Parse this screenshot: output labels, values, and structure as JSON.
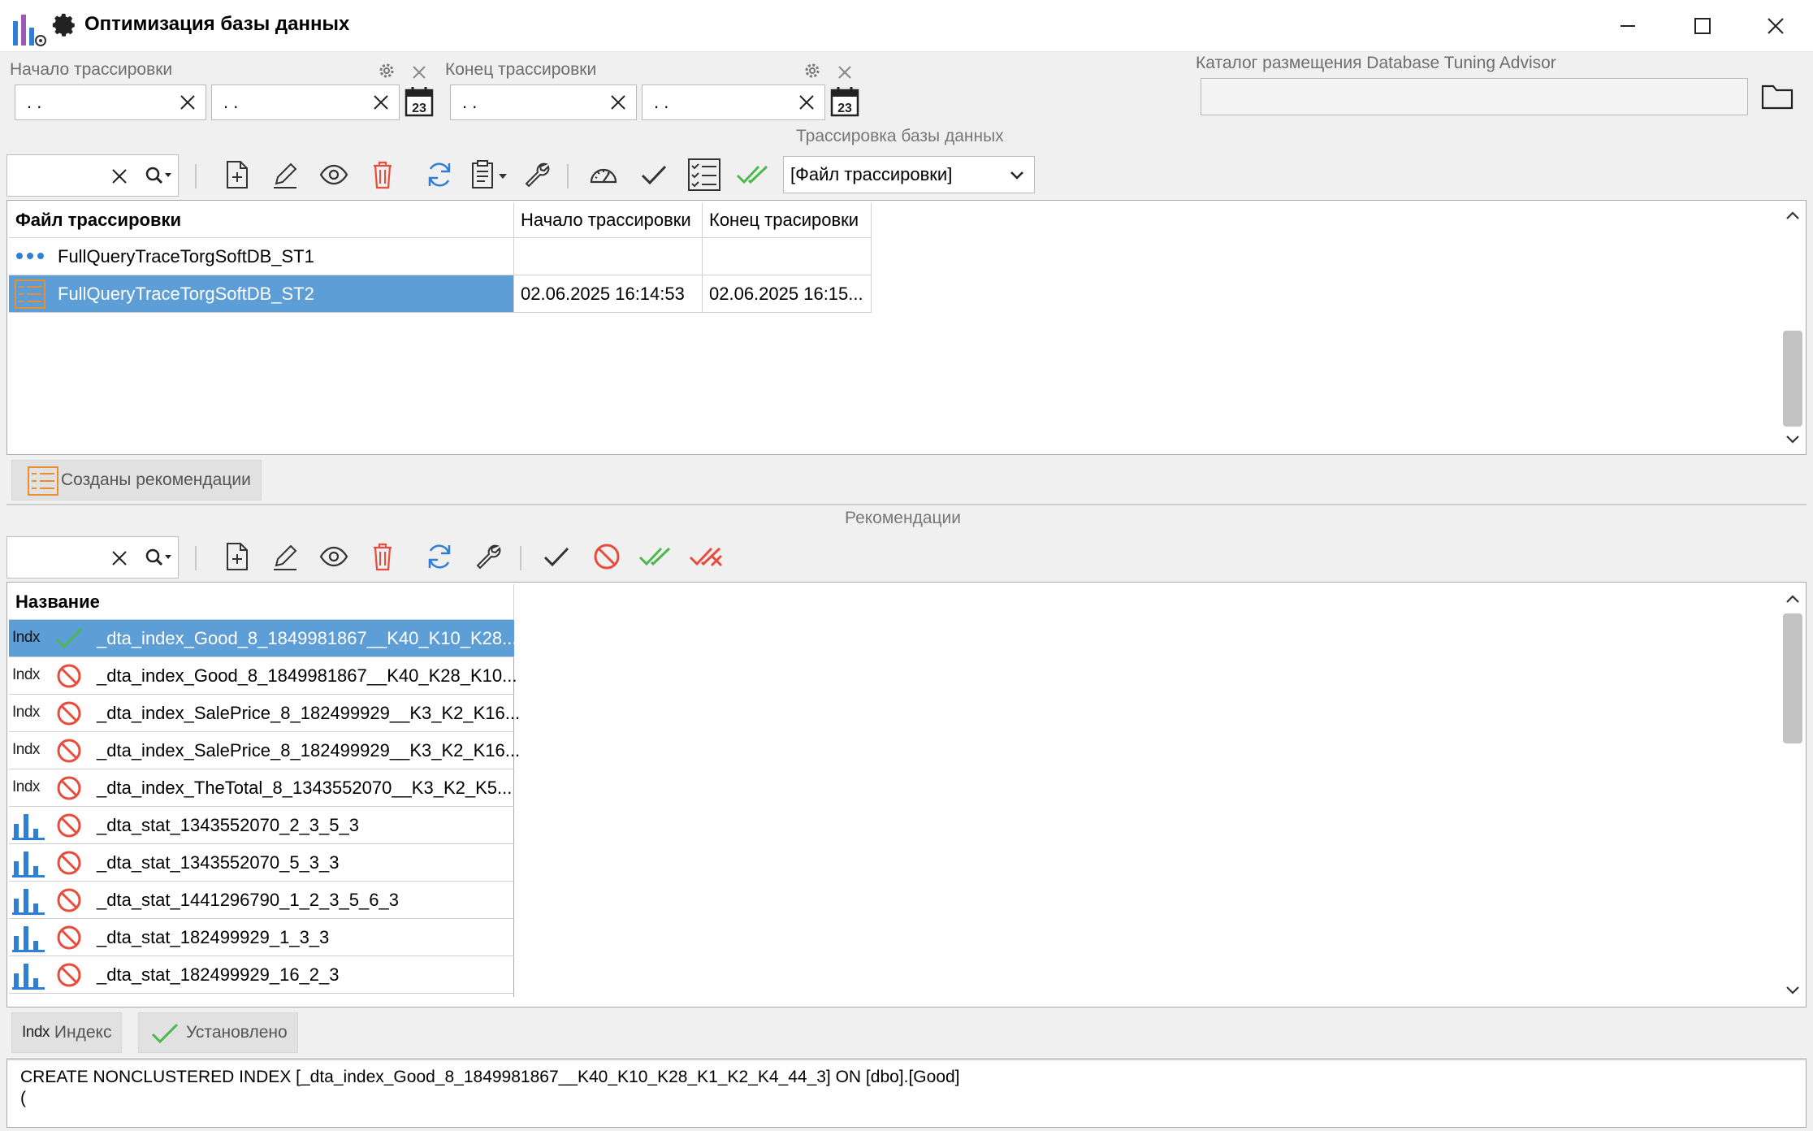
{
  "window": {
    "title": "Оптимизация базы данных"
  },
  "filters": {
    "start_label": "Начало трассировки",
    "end_label": "Конец трассировки",
    "start_date": ". .",
    "start_date2": ". .",
    "end_date": ". .",
    "end_date2": ". .",
    "calendar_day": "23",
    "dta_label": "Каталог размещения Database Tuning Advisor",
    "dta_path": ""
  },
  "trace_toolbar": {
    "group_label": "Трассировка базы данных",
    "dropdown_value": "[Файл трассировки]"
  },
  "trace_grid": {
    "columns": [
      "Файл трассировки",
      "Начало трассировки",
      "Конец трасировки"
    ],
    "rows": [
      {
        "name": "FullQueryTraceTorgSoftDB_ST1",
        "start": "",
        "end": ""
      },
      {
        "name": "FullQueryTraceTorgSoftDB_ST2",
        "start": "02.06.2025 16:14:53",
        "end": "02.06.2025 16:15..."
      }
    ],
    "status_tag": "Созданы рекомендации"
  },
  "recommendations": {
    "group_label": "Рекомендации",
    "column": "Название",
    "indx_text": "Indx",
    "rows": [
      {
        "type": "Indx",
        "status": "applied",
        "name": "_dta_index_Good_8_1849981867__K40_K10_K28..."
      },
      {
        "type": "Indx",
        "status": "rejected",
        "name": "_dta_index_Good_8_1849981867__K40_K28_K10..."
      },
      {
        "type": "Indx",
        "status": "rejected",
        "name": "_dta_index_SalePrice_8_182499929__K3_K2_K16..."
      },
      {
        "type": "Indx",
        "status": "rejected",
        "name": "_dta_index_SalePrice_8_182499929__K3_K2_K16..."
      },
      {
        "type": "Indx",
        "status": "rejected",
        "name": "_dta_index_TheTotal_8_1343552070__K3_K2_K5..."
      },
      {
        "type": "stat",
        "status": "rejected",
        "name": "_dta_stat_1343552070_2_3_5_3"
      },
      {
        "type": "stat",
        "status": "rejected",
        "name": "_dta_stat_1343552070_5_3_3"
      },
      {
        "type": "stat",
        "status": "rejected",
        "name": "_dta_stat_1441296790_1_2_3_5_6_3"
      },
      {
        "type": "stat",
        "status": "rejected",
        "name": "_dta_stat_182499929_1_3_3"
      },
      {
        "type": "stat",
        "status": "rejected",
        "name": "_dta_stat_182499929_16_2_3"
      }
    ],
    "tag_type": "Индекс",
    "tag_status": "Установлено"
  },
  "sql": {
    "line1": "CREATE NONCLUSTERED INDEX [_dta_index_Good_8_1849981867__K40_K10_K28_K1_K2_K4_44_3] ON [dbo].[Good]",
    "line2": "("
  },
  "colors": {
    "selection": "#5e9ed6",
    "accent_blue": "#2f7fd6",
    "delete_red": "#e84c3d",
    "ok_green": "#4cb94c"
  }
}
